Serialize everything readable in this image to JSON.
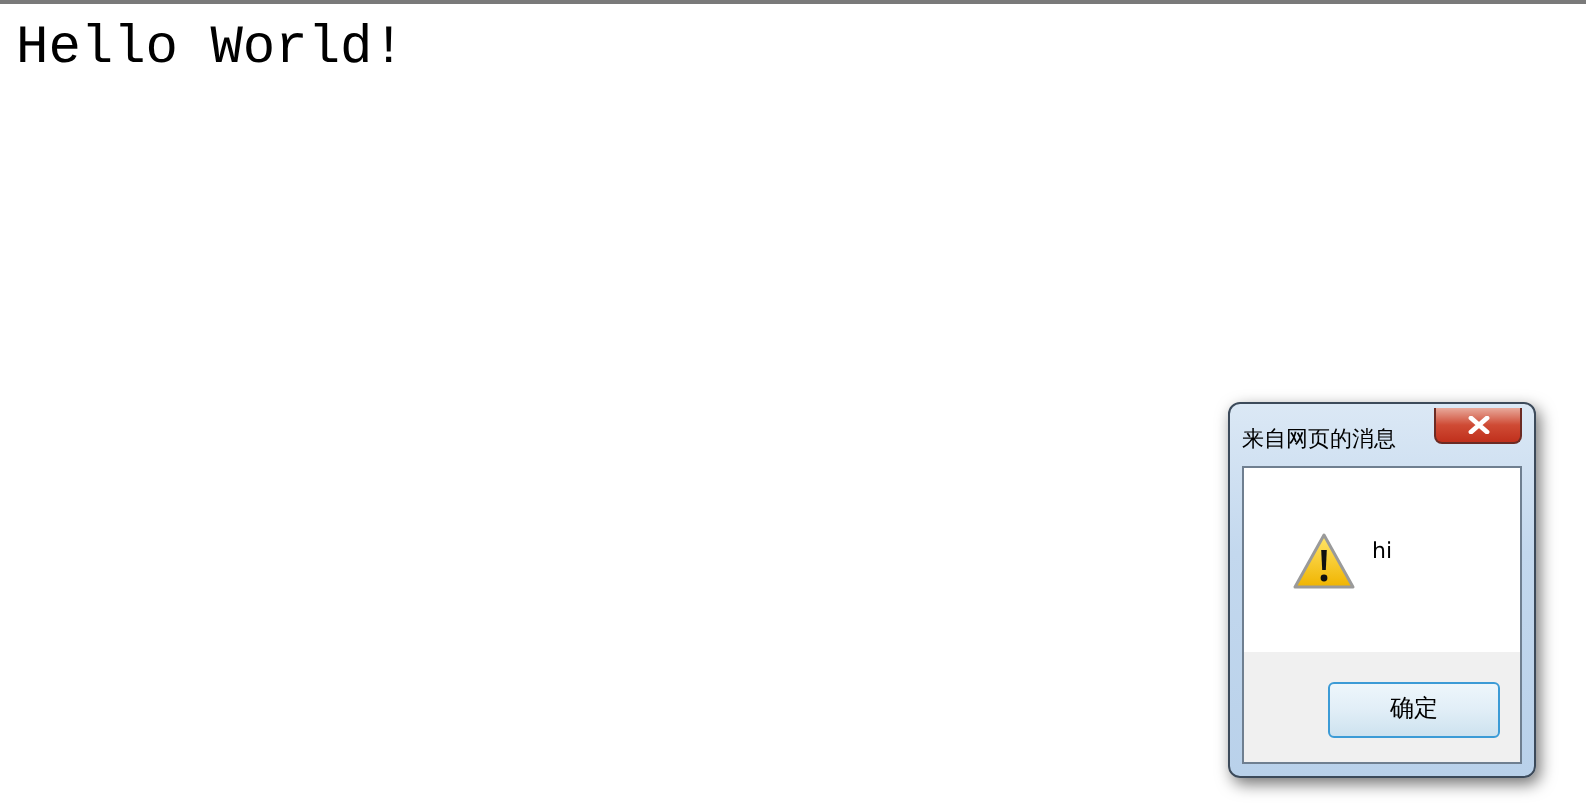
{
  "page": {
    "heading": "Hello World!"
  },
  "dialog": {
    "title": "来自网页的消息",
    "message": "hi",
    "buttons": [
      "确定"
    ]
  }
}
